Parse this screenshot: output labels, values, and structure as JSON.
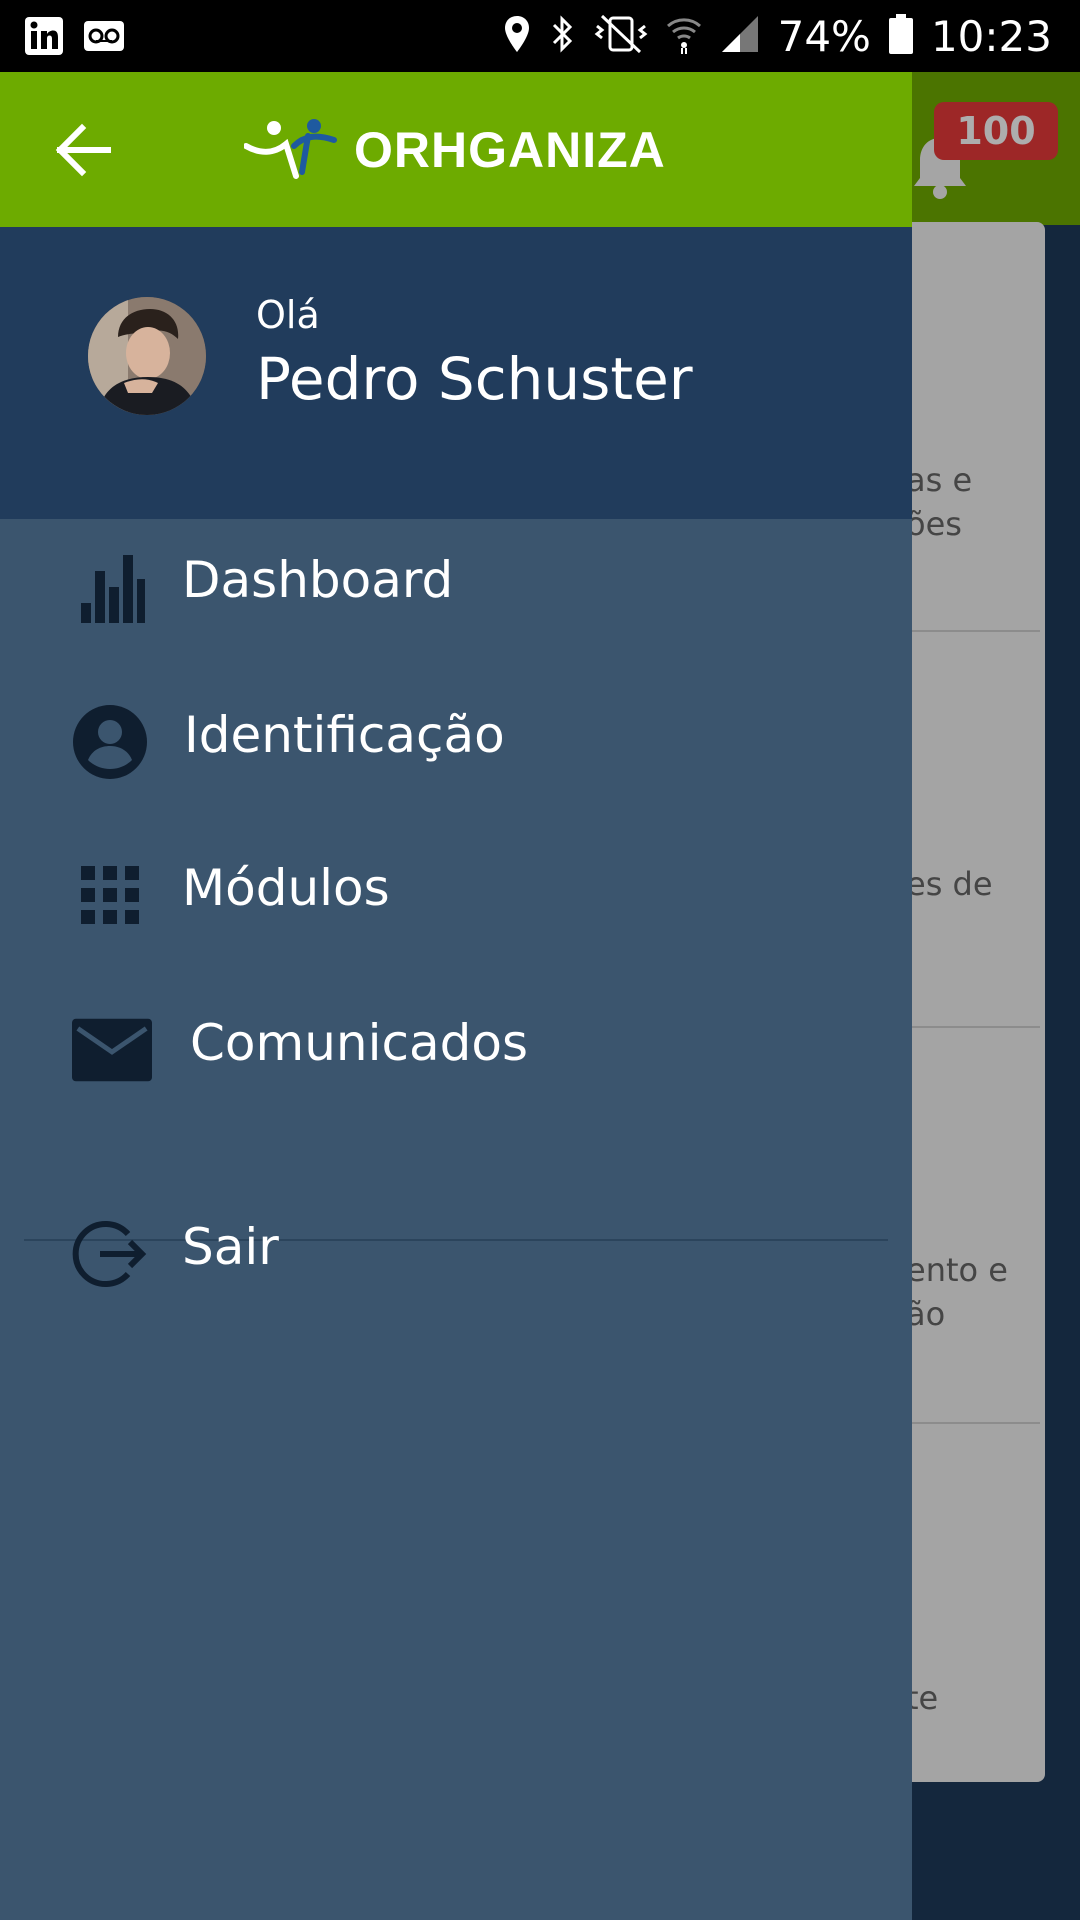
{
  "status_bar": {
    "battery": "74%",
    "time": "10:23",
    "icons": [
      "linkedin-icon",
      "voicemail-icon",
      "location-icon",
      "bluetooth-icon",
      "vibrate-icon",
      "wifi-icon",
      "signal-icon",
      "battery-icon"
    ]
  },
  "app": {
    "brand": "ORHGANIZA",
    "notification_count": "100",
    "background_labels": [
      "as e",
      "ões",
      "es de",
      "ento e",
      "ão",
      "te"
    ]
  },
  "drawer": {
    "greeting": "Olá",
    "user_name": "Pedro Schuster",
    "menu": [
      {
        "label": "Dashboard",
        "icon": "bar-chart-icon"
      },
      {
        "label": "Identificação",
        "icon": "account-circle-icon"
      },
      {
        "label": "Módulos",
        "icon": "grid-icon"
      },
      {
        "label": "Comunicados",
        "icon": "mail-icon"
      }
    ],
    "logout": {
      "label": "Sair",
      "icon": "logout-icon"
    }
  },
  "colors": {
    "header_green": "#6dab00",
    "profile_navy": "#213c5c",
    "drawer_bg": "#3b556e",
    "icon_dark": "#0f1e2f",
    "badge_red": "#e83a3a"
  }
}
